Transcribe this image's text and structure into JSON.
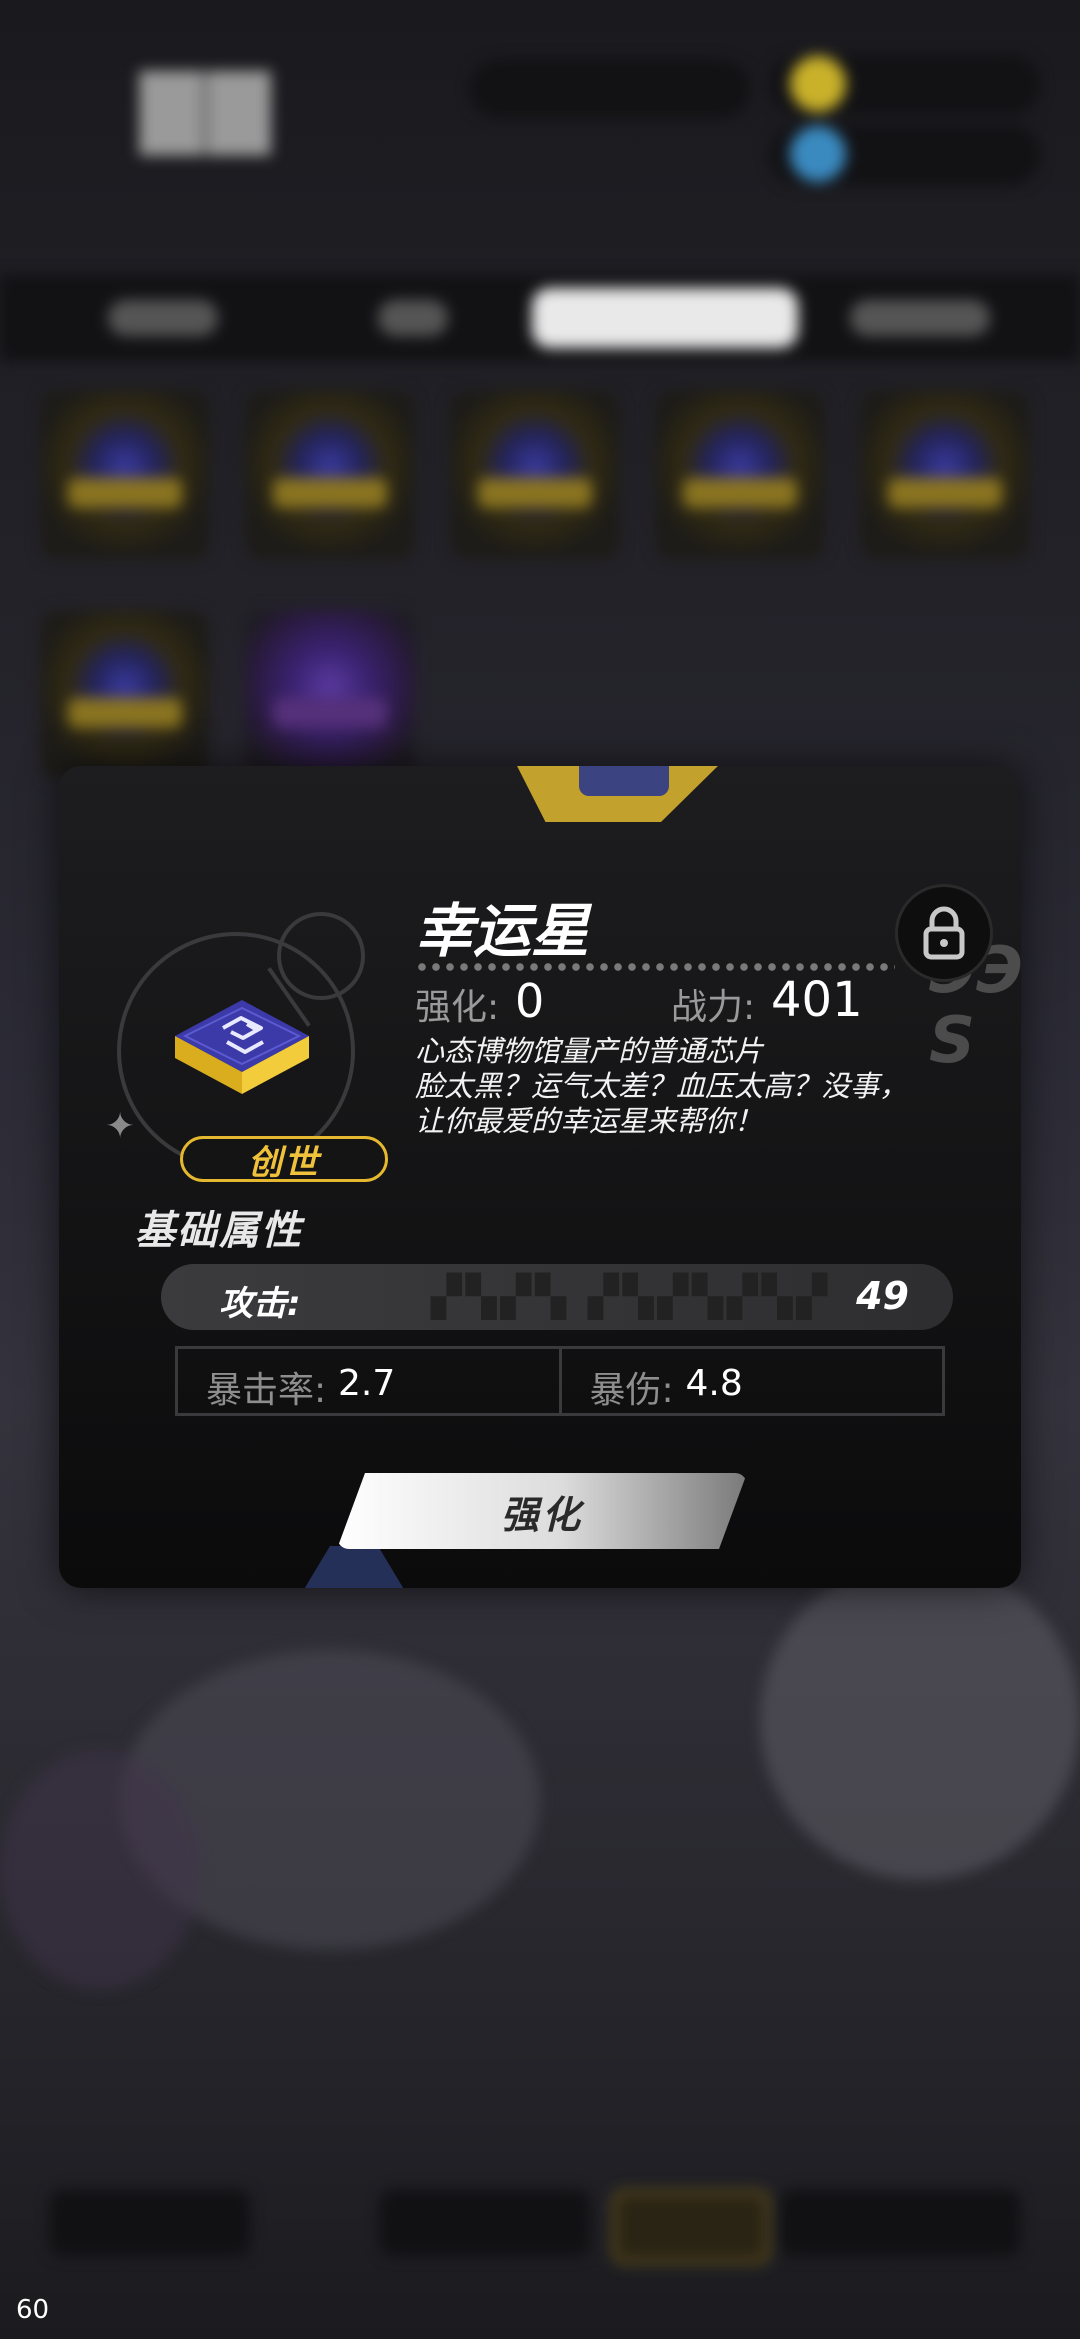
{
  "chip": {
    "name": "幸运星",
    "rarity": "创世",
    "enhance_label": "强化:",
    "enhance_value": "0",
    "power_label": "战力:",
    "power_value": "401",
    "description": [
      "心态博物馆量产的普通芯片",
      "脸太黑？运气太差？血压太高？没事，",
      "让你最爱的幸运星来帮你！"
    ]
  },
  "base_stats": {
    "title": "基础属性",
    "main": {
      "label": "攻击:",
      "value": "49"
    },
    "sub": [
      {
        "label": "暴击率:",
        "value": "2.7"
      },
      {
        "label": "暴伤:",
        "value": "4.8"
      }
    ]
  },
  "actions": {
    "enhance_button": "强化"
  },
  "debug": {
    "fps": "60"
  },
  "colors": {
    "accent_gold": "#e5b830",
    "chip_blue": "#3b3aa8",
    "dialog_bg": "#111112"
  },
  "icons": [
    "lock-icon",
    "sparkle-icon",
    "chip-icon"
  ]
}
